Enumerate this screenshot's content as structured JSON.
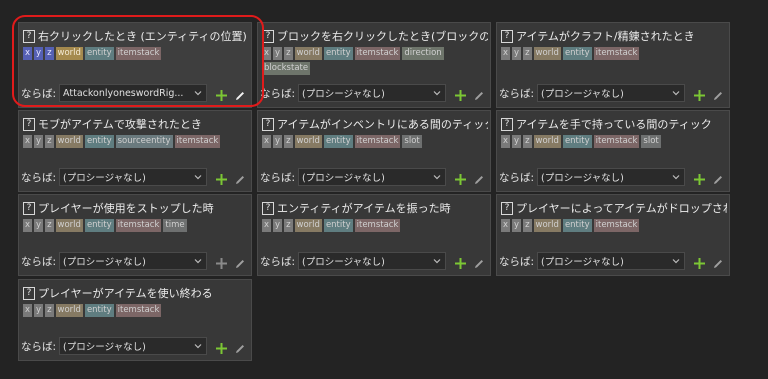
{
  "common": {
    "help_glyph": "?",
    "if_label": "ならば:",
    "no_procedure": "(プロシージャなし)",
    "icon_names": {
      "help": "help-icon",
      "dropdown": "chevron-down-icon",
      "add": "plus-icon",
      "edit": "pencil-icon"
    }
  },
  "colors": {
    "background": "#232323",
    "card": "#383838",
    "highlight": "#e01b1b",
    "add_active": "#7cc734",
    "add_disabled": "#8a8a8a",
    "edit_active": "#f2f2f2",
    "edit_disabled": "#a0a0a0"
  },
  "triggers": [
    {
      "title": "右クリックしたとき (エンティティの位置)",
      "chips": [
        "x",
        "y",
        "z",
        "world",
        "entity",
        "itemstack"
      ],
      "procedure": "AttackonlyoneswordRig...",
      "selected": true,
      "add_active": true,
      "edit_active": true
    },
    {
      "title": "ブロックを右クリックしたとき(ブロックの座標)",
      "chips": [
        "x",
        "y",
        "z",
        "world",
        "entity",
        "itemstack",
        "direction",
        "blockstate"
      ],
      "procedure": "(プロシージャなし)",
      "selected": false,
      "add_active": true,
      "edit_active": false
    },
    {
      "title": "アイテムがクラフト/精錬されたとき",
      "chips": [
        "x",
        "y",
        "z",
        "world",
        "entity",
        "itemstack"
      ],
      "procedure": "(プロシージャなし)",
      "selected": false,
      "add_active": true,
      "edit_active": false
    },
    {
      "title": "モブがアイテムで攻撃されたとき",
      "chips": [
        "x",
        "y",
        "z",
        "world",
        "entity",
        "sourceentity",
        "itemstack"
      ],
      "procedure": "(プロシージャなし)",
      "selected": false,
      "add_active": true,
      "edit_active": false
    },
    {
      "title": "アイテムがインベントリにある間のティック",
      "chips": [
        "x",
        "y",
        "z",
        "world",
        "entity",
        "itemstack",
        "slot"
      ],
      "procedure": "(プロシージャなし)",
      "selected": false,
      "add_active": true,
      "edit_active": false
    },
    {
      "title": "アイテムを手で持っている間のティック",
      "chips": [
        "x",
        "y",
        "z",
        "world",
        "entity",
        "itemstack",
        "slot"
      ],
      "procedure": "(プロシージャなし)",
      "selected": false,
      "add_active": true,
      "edit_active": false
    },
    {
      "title": "プレイヤーが使用をストップした時",
      "chips": [
        "x",
        "y",
        "z",
        "world",
        "entity",
        "itemstack",
        "time"
      ],
      "procedure": "(プロシージャなし)",
      "selected": false,
      "add_active": false,
      "edit_active": false
    },
    {
      "title": "エンティティがアイテムを振った時",
      "chips": [
        "x",
        "y",
        "z",
        "world",
        "entity",
        "itemstack"
      ],
      "procedure": "(プロシージャなし)",
      "selected": false,
      "add_active": true,
      "edit_active": false
    },
    {
      "title": "プレイヤーによってアイテムがドロップされたとき",
      "chips": [
        "x",
        "y",
        "z",
        "world",
        "entity",
        "itemstack"
      ],
      "procedure": "(プロシージャなし)",
      "selected": false,
      "add_active": true,
      "edit_active": false
    },
    {
      "title": "プレイヤーがアイテムを使い終わる",
      "chips": [
        "x",
        "y",
        "z",
        "world",
        "entity",
        "itemstack"
      ],
      "procedure": "(プロシージャなし)",
      "selected": false,
      "add_active": true,
      "edit_active": false
    }
  ]
}
